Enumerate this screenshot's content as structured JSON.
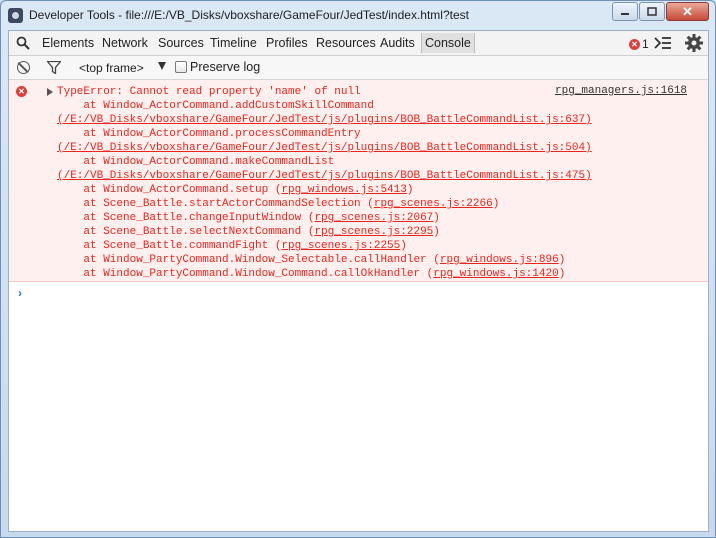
{
  "window": {
    "title": "Developer Tools - file:///E:/VB_Disks/vboxshare/GameFour/JedTest/index.html?test",
    "close_label": "✕"
  },
  "tabs": [
    {
      "label": "Elements"
    },
    {
      "label": "Network"
    },
    {
      "label": "Sources"
    },
    {
      "label": "Timeline"
    },
    {
      "label": "Profiles"
    },
    {
      "label": "Resources"
    },
    {
      "label": "Audits"
    },
    {
      "label": "Console",
      "active": true
    }
  ],
  "error_count": "1",
  "filterbar": {
    "frame": "<top frame>",
    "preserve_log": "Preserve log"
  },
  "error": {
    "source_link": "rpg_managers.js:1618",
    "lines": [
      {
        "text": "TypeError: Cannot read property 'name' of null",
        "link": ""
      },
      {
        "text": "    at Window_ActorCommand.addCustomSkillCommand",
        "link": ""
      },
      {
        "text": "",
        "link": "(/E:/VB_Disks/vboxshare/GameFour/JedTest/js/plugins/BOB_BattleCommandList.js:637)"
      },
      {
        "text": "    at Window_ActorCommand.processCommandEntry",
        "link": ""
      },
      {
        "text": "",
        "link": "(/E:/VB_Disks/vboxshare/GameFour/JedTest/js/plugins/BOB_BattleCommandList.js:504)"
      },
      {
        "text": "    at Window_ActorCommand.makeCommandList",
        "link": ""
      },
      {
        "text": "",
        "link": "(/E:/VB_Disks/vboxshare/GameFour/JedTest/js/plugins/BOB_BattleCommandList.js:475)"
      },
      {
        "text": "    at Window_ActorCommand.setup (",
        "link": "rpg_windows.js:5413",
        "tail": ")"
      },
      {
        "text": "    at Scene_Battle.startActorCommandSelection (",
        "link": "rpg_scenes.js:2266",
        "tail": ")"
      },
      {
        "text": "    at Scene_Battle.changeInputWindow (",
        "link": "rpg_scenes.js:2067",
        "tail": ")"
      },
      {
        "text": "    at Scene_Battle.selectNextCommand (",
        "link": "rpg_scenes.js:2295",
        "tail": ")"
      },
      {
        "text": "    at Scene_Battle.commandFight (",
        "link": "rpg_scenes.js:2255",
        "tail": ")"
      },
      {
        "text": "    at Window_PartyCommand.Window_Selectable.callHandler (",
        "link": "rpg_windows.js:896",
        "tail": ")"
      },
      {
        "text": "    at Window_PartyCommand.Window_Command.callOkHandler (",
        "link": "rpg_windows.js:1420",
        "tail": ")"
      }
    ]
  },
  "prompt_symbol": "›",
  "colors": {
    "error_text": "#e8261c",
    "error_bg": "#fff0f0",
    "prompt": "#2a6fd6"
  }
}
